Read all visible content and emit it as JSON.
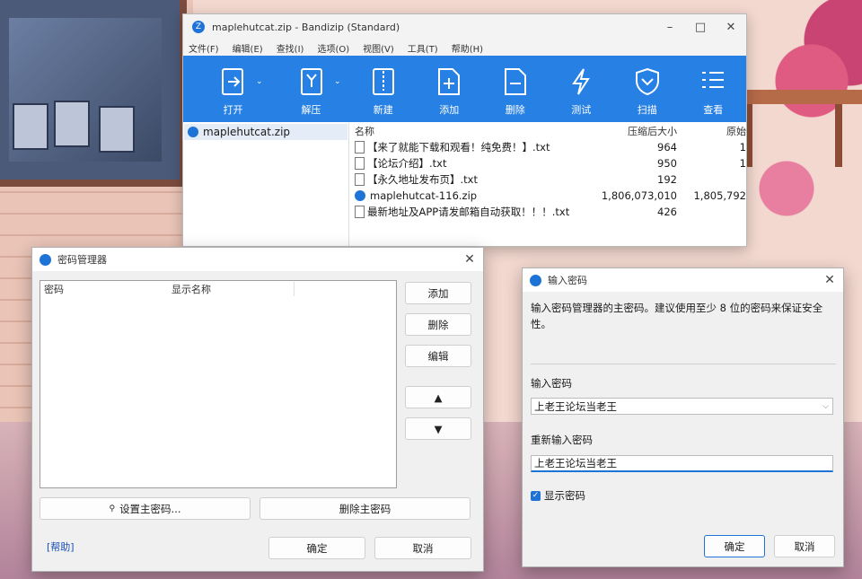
{
  "bandizip": {
    "title": "maplehutcat.zip - Bandizip (Standard)",
    "menu": [
      "文件(F)",
      "编辑(E)",
      "查找(I)",
      "选项(O)",
      "视图(V)",
      "工具(T)",
      "帮助(H)"
    ],
    "toolbar": [
      "打开",
      "解压",
      "新建",
      "添加",
      "删除",
      "测试",
      "扫描",
      "查看"
    ],
    "tree_item": "maplehutcat.zip",
    "columns": {
      "name": "名称",
      "packed": "压缩后大小",
      "orig": "原始"
    },
    "files": [
      {
        "name": "【来了就能下载和观看！纯免费！】.txt",
        "packed": "964",
        "orig": "1"
      },
      {
        "name": "【论坛介绍】.txt",
        "packed": "950",
        "orig": "1"
      },
      {
        "name": "【永久地址发布页】.txt",
        "packed": "192",
        "orig": ""
      },
      {
        "name": "maplehutcat-116.zip",
        "packed": "1,806,073,010",
        "orig": "1,805,792"
      },
      {
        "name": "最新地址及APP请发邮箱自动获取！！！.txt",
        "packed": "426",
        "orig": ""
      }
    ]
  },
  "pm": {
    "title": "密码管理器",
    "col_password": "密码",
    "col_display": "显示名称",
    "add": "添加",
    "delete": "删除",
    "edit": "编辑",
    "up": "▲",
    "down": "▼",
    "set_master": "设置主密码...",
    "delete_master": "删除主密码",
    "help": "[帮助]",
    "ok": "确定",
    "cancel": "取消"
  },
  "ip": {
    "title": "输入密码",
    "desc": "输入密码管理器的主密码。建议使用至少 8 位的密码来保证安全性。",
    "label1": "输入密码",
    "value1": "上老王论坛当老王",
    "label2": "重新输入密码",
    "value2": "上老王论坛当老王",
    "show": "显示密码",
    "ok": "确定",
    "cancel": "取消"
  }
}
